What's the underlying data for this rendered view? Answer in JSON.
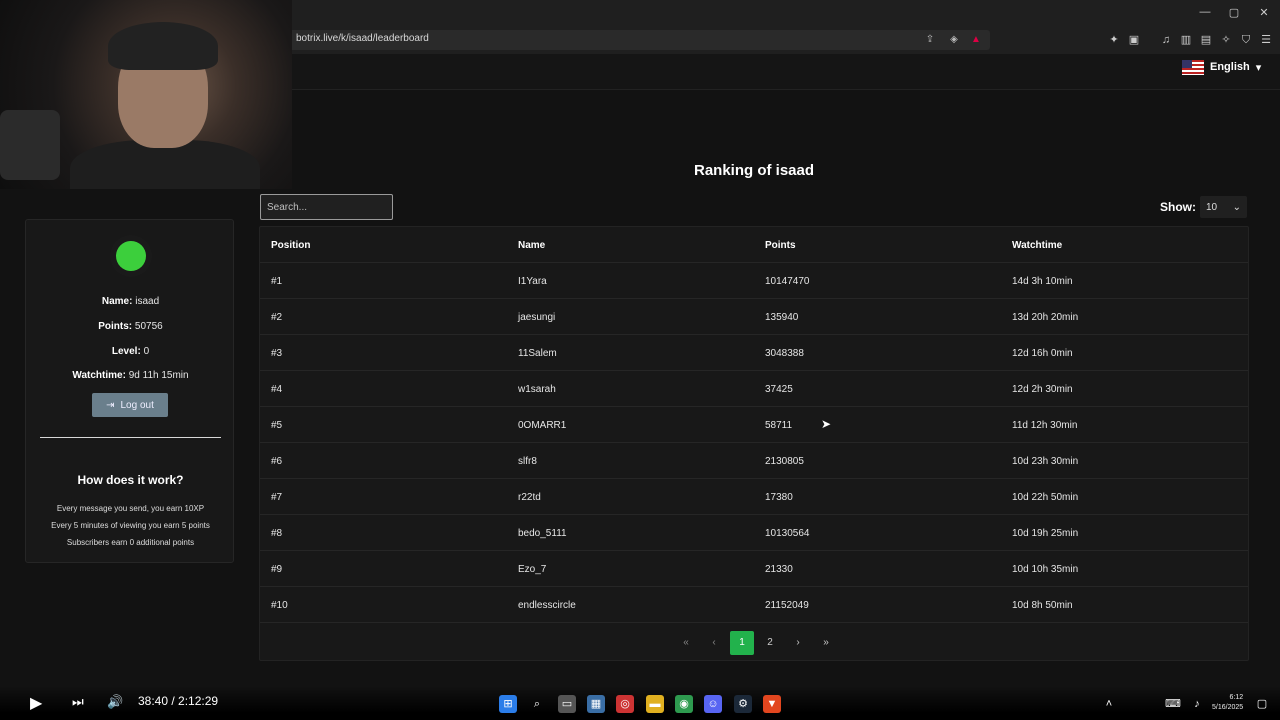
{
  "browser": {
    "url": "botrix.live/k/isaad/leaderboard",
    "window_controls": [
      "—",
      "▢",
      "✕"
    ]
  },
  "header": {
    "language": "English",
    "language_chevron": "▾"
  },
  "page": {
    "title": "Ranking of isaad"
  },
  "profile": {
    "name_label": "Name:",
    "name": "isaad",
    "points_label": "Points:",
    "points": "50756",
    "level_label": "Level:",
    "level": "0",
    "watchtime_label": "Watchtime:",
    "watchtime": "9d 11h 15min",
    "logout_label": "Log out",
    "how_title": "How does it work?",
    "how_lines": [
      "Every message you send, you earn 10XP",
      "Every 5 minutes of viewing you earn 5 points",
      "Subscribers earn 0 additional points"
    ]
  },
  "search": {
    "placeholder": "Search..."
  },
  "show": {
    "label": "Show:",
    "value": "10"
  },
  "table": {
    "headers": [
      "Position",
      "Name",
      "Points",
      "Watchtime"
    ],
    "rows": [
      [
        "#1",
        "I1Yara",
        "10147470",
        "14d 3h 10min"
      ],
      [
        "#2",
        "jaesungi",
        "135940",
        "13d 20h 20min"
      ],
      [
        "#3",
        "11Salem",
        "3048388",
        "12d 16h 0min"
      ],
      [
        "#4",
        "w1sarah",
        "37425",
        "12d 2h 30min"
      ],
      [
        "#5",
        "0OMARR1",
        "58711",
        "11d 12h 30min"
      ],
      [
        "#6",
        "slfr8",
        "2130805",
        "10d 23h 30min"
      ],
      [
        "#7",
        "r22td",
        "17380",
        "10d 22h 50min"
      ],
      [
        "#8",
        "bedo_5111",
        "10130564",
        "10d 19h 25min"
      ],
      [
        "#9",
        "Ezo_7",
        "21330",
        "10d 10h 35min"
      ],
      [
        "#10",
        "endlesscircle",
        "21152049",
        "10d 8h 50min"
      ]
    ]
  },
  "pagination": {
    "first": "«",
    "prev": "‹",
    "pages": [
      "1",
      "2"
    ],
    "next": "›",
    "last": "»",
    "current": "1"
  },
  "player": {
    "time": "38:40 / 2:12:29"
  },
  "taskbar": {
    "clock_time": "6:12",
    "clock_date": "5/16/2025"
  },
  "colors": {
    "accent_green": "#22b24c",
    "background": "#121212",
    "logout_button": "#6a7f8c"
  }
}
